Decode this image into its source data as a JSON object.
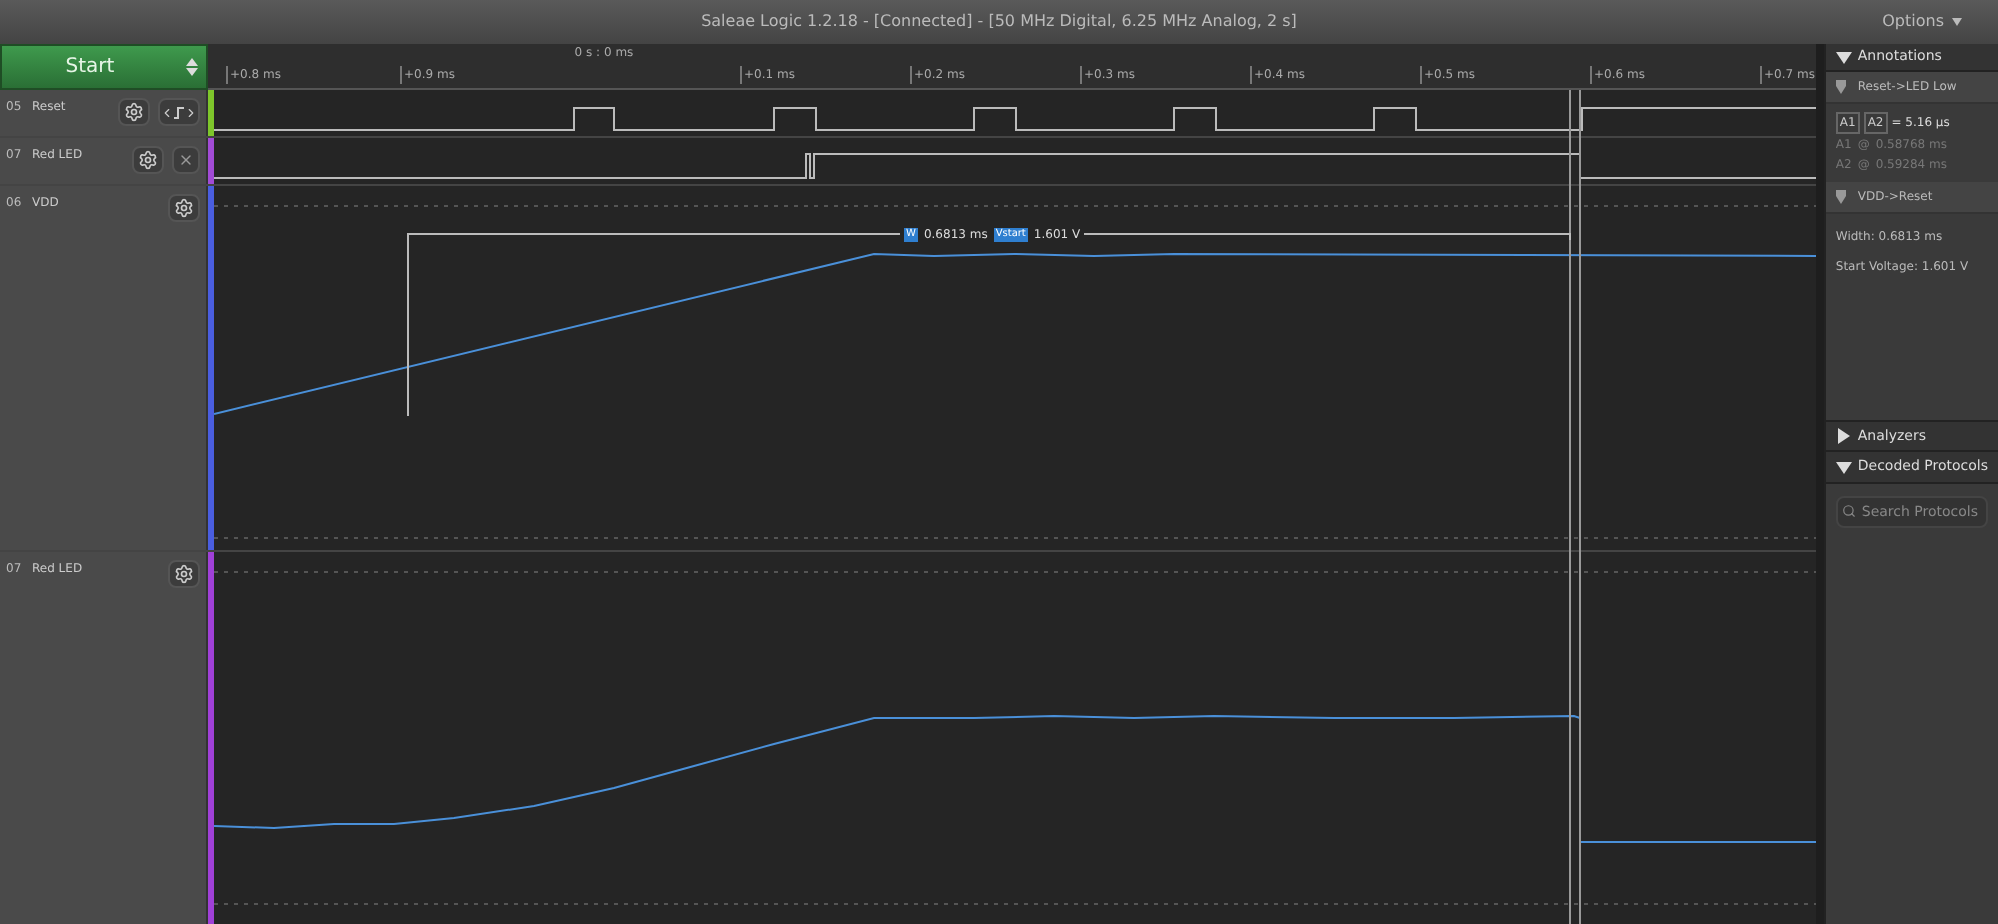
{
  "window": {
    "title": "Saleae Logic 1.2.18 - [Connected] - [50 MHz Digital, 6.25 MHz Analog, 2 s]",
    "menu": "Options"
  },
  "start_button": "Start",
  "ruler": {
    "origin": "0 s : 0 ms",
    "ticks": [
      "+0.8 ms",
      "+0.9 ms",
      "+0.1 ms",
      "+0.2 ms",
      "+0.3 ms",
      "+0.4 ms",
      "+0.5 ms",
      "+0.6 ms",
      "+0.7 ms"
    ]
  },
  "channels": [
    {
      "number": "05",
      "name": "Reset",
      "kind": "digital",
      "color": "#7ec62b"
    },
    {
      "number": "07",
      "name": "Red LED",
      "kind": "digital",
      "color": "#a24bd6"
    },
    {
      "number": "06",
      "name": "VDD",
      "kind": "analog",
      "color": "#4a5ee0"
    },
    {
      "number": "07",
      "name": "Red LED",
      "kind": "analog",
      "color": "#a040d8"
    }
  ],
  "measurement": {
    "width_badge": "W",
    "width": "0.6813 ms",
    "voltage_badge": "Vstart",
    "voltage": "1.601 V"
  },
  "annotations": {
    "title": "Annotations",
    "expanded": true,
    "items": [
      {
        "name": "Reset->LED Low",
        "kind": "timing",
        "diff_a": "A1",
        "diff_b": "A2",
        "diff": "= 5.16 µs",
        "rows": [
          {
            "marker": "A1",
            "at": "@",
            "value": "0.58768 ms"
          },
          {
            "marker": "A2",
            "at": "@",
            "value": "0.59284 ms"
          }
        ]
      },
      {
        "name": "VDD->Reset",
        "kind": "width",
        "lines": [
          "Width: 0.6813 ms",
          "Start Voltage: 1.601 V"
        ]
      }
    ]
  },
  "analyzers": {
    "title": "Analyzers",
    "expanded": false
  },
  "decoded_protocols": {
    "title": "Decoded Protocols",
    "expanded": true,
    "search": {
      "placeholder": "Search Protocols"
    }
  }
}
